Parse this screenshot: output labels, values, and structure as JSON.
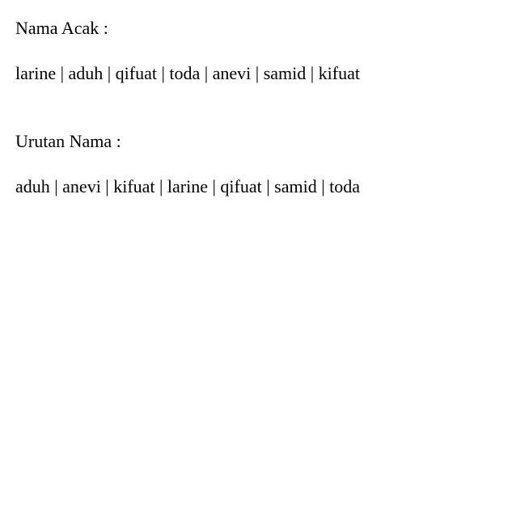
{
  "random_section": {
    "heading": "Nama Acak :",
    "names_line": "larine | aduh | qifuat | toda | anevi | samid | kifuat"
  },
  "sorted_section": {
    "heading": "Urutan Nama :",
    "names_line": "aduh | anevi | kifuat | larine | qifuat | samid | toda"
  }
}
